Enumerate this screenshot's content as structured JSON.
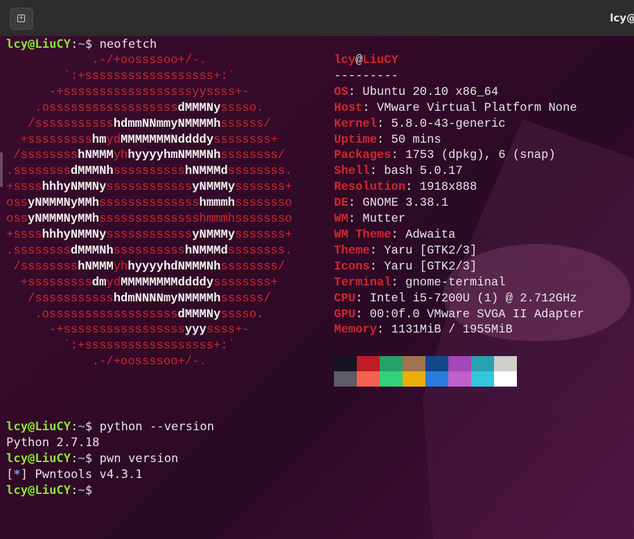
{
  "window": {
    "title": "lcy@",
    "new_tab_icon": "new-tab-icon"
  },
  "prompt": {
    "user": "lcy@LiuCY",
    "sep": ":",
    "path": "~",
    "dollar": "$ "
  },
  "commands": {
    "c1": "neofetch",
    "c2": "python --version",
    "c3": "pwn version"
  },
  "output": {
    "python_version": "Python 2.7.18",
    "pwn_bracket_open": "[",
    "pwn_star": "*",
    "pwn_bracket_close": "]",
    "pwn_rest": " Pwntools v4.3.1"
  },
  "logo_lines": [
    [
      [
        "r",
        "            .-/+oossssoo+/-."
      ]
    ],
    [
      [
        "r",
        "        `:+ssssssssssssssssss+:`"
      ]
    ],
    [
      [
        "r",
        "      -+ssssssssssssssssssyyssss+-"
      ]
    ],
    [
      [
        "r",
        "    .ossssssssssssssssss"
      ],
      [
        "wb",
        "dMMMNy"
      ],
      [
        "r",
        "sssso."
      ]
    ],
    [
      [
        "r",
        "   /sssssssssss"
      ],
      [
        "wb",
        "hdmmNNmmyNMMMMh"
      ],
      [
        "r",
        "ssssss/"
      ]
    ],
    [
      [
        "r",
        "  +sssssssss"
      ],
      [
        "wb",
        "hm"
      ],
      [
        "r",
        "yd"
      ],
      [
        "wb",
        "MMMMMMMNddddy"
      ],
      [
        "r",
        "ssssssss+"
      ]
    ],
    [
      [
        "r",
        " /ssssssss"
      ],
      [
        "wb",
        "hNMMM"
      ],
      [
        "r",
        "yh"
      ],
      [
        "wb",
        "hyyyyhmNMMMNh"
      ],
      [
        "r",
        "ssssssss/"
      ]
    ],
    [
      [
        "r",
        ".ssssssss"
      ],
      [
        "wb",
        "dMMMNh"
      ],
      [
        "r",
        "ssssssssss"
      ],
      [
        "wb",
        "hNMMMd"
      ],
      [
        "r",
        "ssssssss."
      ]
    ],
    [
      [
        "r",
        "+ssss"
      ],
      [
        "wb",
        "hhhyNMMNy"
      ],
      [
        "r",
        "ssssssssssss"
      ],
      [
        "wb",
        "yNMMMy"
      ],
      [
        "r",
        "sssssss+"
      ]
    ],
    [
      [
        "r",
        "oss"
      ],
      [
        "wb",
        "yNMMMNyMMh"
      ],
      [
        "r",
        "ssssssssssssss"
      ],
      [
        "wb",
        "hmmmh"
      ],
      [
        "r",
        "ssssssso"
      ]
    ],
    [
      [
        "r",
        "oss"
      ],
      [
        "wb",
        "yNMMMNyMMh"
      ],
      [
        "r",
        "sssssssssssssshmmmhssssssso"
      ]
    ],
    [
      [
        "r",
        "+ssss"
      ],
      [
        "wb",
        "hhhyNMMNy"
      ],
      [
        "r",
        "ssssssssssss"
      ],
      [
        "wb",
        "yNMMMy"
      ],
      [
        "r",
        "sssssss+"
      ]
    ],
    [
      [
        "r",
        ".ssssssss"
      ],
      [
        "wb",
        "dMMMNh"
      ],
      [
        "r",
        "ssssssssss"
      ],
      [
        "wb",
        "hNMMMd"
      ],
      [
        "r",
        "ssssssss."
      ]
    ],
    [
      [
        "r",
        " /ssssssss"
      ],
      [
        "wb",
        "hNMMM"
      ],
      [
        "r",
        "yh"
      ],
      [
        "wb",
        "hyyyyhdNMMMNh"
      ],
      [
        "r",
        "ssssssss/"
      ]
    ],
    [
      [
        "r",
        "  +sssssssss"
      ],
      [
        "wb",
        "dm"
      ],
      [
        "r",
        "yd"
      ],
      [
        "wb",
        "MMMMMMMMddddy"
      ],
      [
        "r",
        "ssssssss+"
      ]
    ],
    [
      [
        "r",
        "   /sssssssssss"
      ],
      [
        "wb",
        "hdmNNNNmyNMMMMh"
      ],
      [
        "r",
        "ssssss/"
      ]
    ],
    [
      [
        "r",
        "    .ossssssssssssssssss"
      ],
      [
        "wb",
        "dMMMNy"
      ],
      [
        "r",
        "sssso."
      ]
    ],
    [
      [
        "r",
        "      -+sssssssssssssssss"
      ],
      [
        "wb",
        "yyy"
      ],
      [
        "r",
        "ssss+-"
      ]
    ],
    [
      [
        "r",
        "        `:+ssssssssssssssssss+:`"
      ]
    ],
    [
      [
        "r",
        "            .-/+oossssoo+/-."
      ]
    ]
  ],
  "info": {
    "header_user": "lcy",
    "header_at": "@",
    "header_host": "LiuCY",
    "divider": "---------",
    "fields": [
      {
        "key": "OS",
        "value": "Ubuntu 20.10 x86_64"
      },
      {
        "key": "Host",
        "value": "VMware Virtual Platform None"
      },
      {
        "key": "Kernel",
        "value": "5.8.0-43-generic"
      },
      {
        "key": "Uptime",
        "value": "50 mins"
      },
      {
        "key": "Packages",
        "value": "1753 (dpkg), 6 (snap)"
      },
      {
        "key": "Shell",
        "value": "bash 5.0.17"
      },
      {
        "key": "Resolution",
        "value": "1918x888"
      },
      {
        "key": "DE",
        "value": "GNOME 3.38.1"
      },
      {
        "key": "WM",
        "value": "Mutter"
      },
      {
        "key": "WM Theme",
        "value": "Adwaita"
      },
      {
        "key": "Theme",
        "value": "Yaru [GTK2/3]"
      },
      {
        "key": "Icons",
        "value": "Yaru [GTK2/3]"
      },
      {
        "key": "Terminal",
        "value": "gnome-terminal"
      },
      {
        "key": "CPU",
        "value": "Intel i5-7200U (1) @ 2.712GHz"
      },
      {
        "key": "GPU",
        "value": "00:0f.0 VMware SVGA II Adapter"
      },
      {
        "key": "Memory",
        "value": "1131MiB / 1955MiB"
      }
    ],
    "separator": ": "
  },
  "palette": {
    "row1": [
      "#171421",
      "#c01c28",
      "#26a269",
      "#a2734c",
      "#12488b",
      "#a347ba",
      "#2aa1b3",
      "#d0cfcc"
    ],
    "row2": [
      "#5e5c64",
      "#f66151",
      "#33d17a",
      "#e9ad0c",
      "#2a7bde",
      "#c061cb",
      "#33c7de",
      "#ffffff"
    ]
  }
}
